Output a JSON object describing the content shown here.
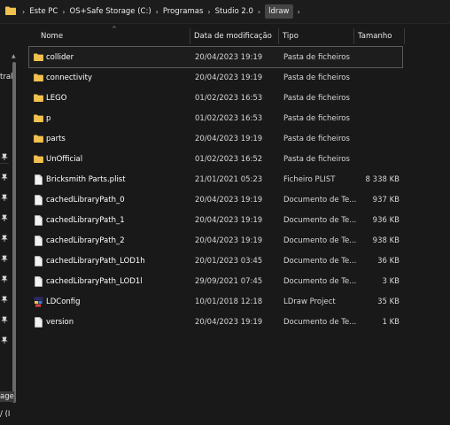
{
  "address_bar": {
    "crumbs": [
      "Este PC",
      "OS+Safe Storage (C:)",
      "Programas",
      "Studio 2.0",
      "ldraw"
    ]
  },
  "nav_pane": {
    "fragments": [
      "tral",
      "age",
      "/ (I"
    ]
  },
  "columns": {
    "name": "Nome",
    "date": "Data de modificação",
    "type": "Tipo",
    "size": "Tamanho"
  },
  "files": [
    {
      "name": "collider",
      "date": "20/04/2023 19:19",
      "type": "Pasta de ficheiros",
      "size": "",
      "icon": "folder-icon",
      "selected": true
    },
    {
      "name": "connectivity",
      "date": "20/04/2023 19:19",
      "type": "Pasta de ficheiros",
      "size": "",
      "icon": "folder-icon"
    },
    {
      "name": "LEGO",
      "date": "01/02/2023 16:53",
      "type": "Pasta de ficheiros",
      "size": "",
      "icon": "folder-icon"
    },
    {
      "name": "p",
      "date": "01/02/2023 16:53",
      "type": "Pasta de ficheiros",
      "size": "",
      "icon": "folder-icon"
    },
    {
      "name": "parts",
      "date": "20/04/2023 19:19",
      "type": "Pasta de ficheiros",
      "size": "",
      "icon": "folder-icon"
    },
    {
      "name": "UnOfficial",
      "date": "01/02/2023 16:52",
      "type": "Pasta de ficheiros",
      "size": "",
      "icon": "folder-icon"
    },
    {
      "name": "Bricksmith Parts.plist",
      "date": "21/01/2021 05:23",
      "type": "Ficheiro PLIST",
      "size": "8 338 KB",
      "icon": "file-icon"
    },
    {
      "name": "cachedLibraryPath_0",
      "date": "20/04/2023 19:19",
      "type": "Documento de Te...",
      "size": "937 KB",
      "icon": "file-icon"
    },
    {
      "name": "cachedLibraryPath_1",
      "date": "20/04/2023 19:19",
      "type": "Documento de Te...",
      "size": "936 KB",
      "icon": "file-icon"
    },
    {
      "name": "cachedLibraryPath_2",
      "date": "20/04/2023 19:19",
      "type": "Documento de Te...",
      "size": "938 KB",
      "icon": "file-icon"
    },
    {
      "name": "cachedLibraryPath_LOD1h",
      "date": "20/01/2023 03:45",
      "type": "Documento de Te...",
      "size": "36 KB",
      "icon": "file-icon"
    },
    {
      "name": "cachedLibraryPath_LOD1l",
      "date": "29/09/2021 07:45",
      "type": "Documento de Te...",
      "size": "3 KB",
      "icon": "file-icon"
    },
    {
      "name": "LDConfig",
      "date": "10/01/2018 12:18",
      "type": "LDraw Project",
      "size": "35 KB",
      "icon": "ldraw-icon"
    },
    {
      "name": "version",
      "date": "20/04/2023 19:19",
      "type": "Documento de Te...",
      "size": "1 KB",
      "icon": "file-icon"
    }
  ],
  "colors": {
    "background": "#191919",
    "folder": "#f2c14e",
    "text": "#ffffff",
    "text_secondary": "#d6d6d6"
  }
}
